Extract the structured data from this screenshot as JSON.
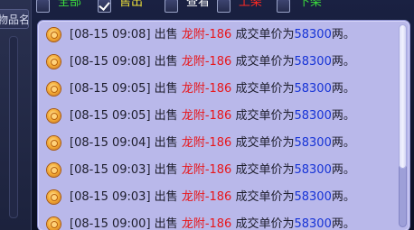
{
  "left_panel": {
    "tab_label": "物品名"
  },
  "filters": [
    {
      "label": "全部",
      "checked": false,
      "color": "#3ddc3d"
    },
    {
      "label": "售出",
      "checked": true,
      "color": "#f2e33a"
    },
    {
      "label": "查看",
      "checked": false,
      "color": "#ffffff"
    },
    {
      "label": "上架",
      "checked": false,
      "color": "#ff2a22"
    },
    {
      "label": "下架",
      "checked": false,
      "color": "#3ddc3d"
    }
  ],
  "log": {
    "entries": [
      {
        "time": "[08-15 09:08]",
        "action": "出售",
        "item": "龙附-186",
        "text": "成交单价为",
        "price": "58300",
        "unit": "两。"
      },
      {
        "time": "[08-15 09:08]",
        "action": "出售",
        "item": "龙附-186",
        "text": "成交单价为",
        "price": "58300",
        "unit": "两。"
      },
      {
        "time": "[08-15 09:05]",
        "action": "出售",
        "item": "龙附-186",
        "text": "成交单价为",
        "price": "58300",
        "unit": "两。"
      },
      {
        "time": "[08-15 09:05]",
        "action": "出售",
        "item": "龙附-186",
        "text": "成交单价为",
        "price": "58300",
        "unit": "两。"
      },
      {
        "time": "[08-15 09:04]",
        "action": "出售",
        "item": "龙附-186",
        "text": "成交单价为",
        "price": "58300",
        "unit": "两。"
      },
      {
        "time": "[08-15 09:03]",
        "action": "出售",
        "item": "龙附-186",
        "text": "成交单价为",
        "price": "58300",
        "unit": "两。"
      },
      {
        "time": "[08-15 09:03]",
        "action": "出售",
        "item": "龙附-186",
        "text": "成交单价为",
        "price": "58300",
        "unit": "两。"
      },
      {
        "time": "[08-15 09:00]",
        "action": "出售",
        "item": "龙附-186",
        "text": "成交单价为",
        "price": "58300",
        "unit": "两。"
      }
    ]
  },
  "colors": {
    "panel_bg": "#b9b8ea",
    "item_color": "#e8161a",
    "price_color": "#1633d6"
  }
}
